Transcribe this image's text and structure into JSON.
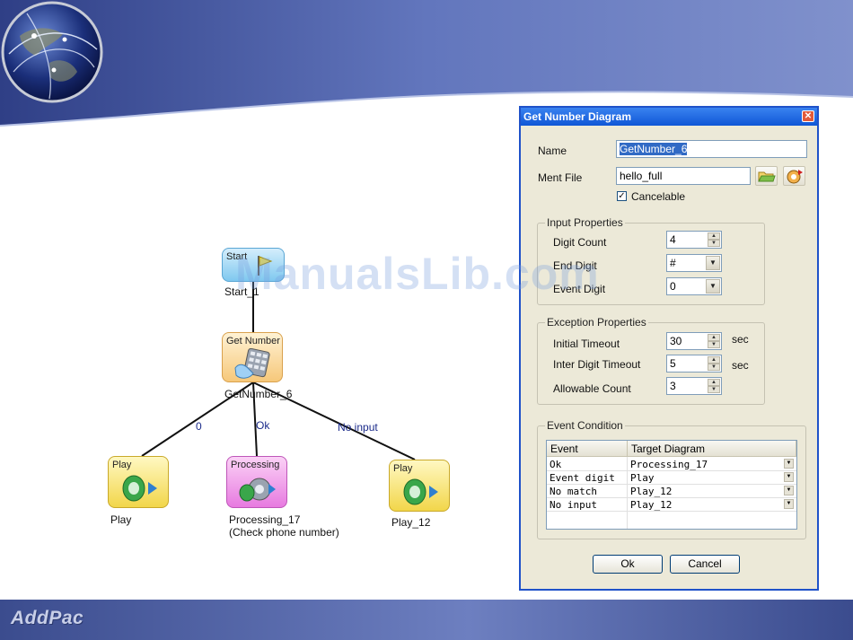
{
  "brand": {
    "logo_text": "AddPac"
  },
  "watermark": "ManualsLib.com",
  "flow": {
    "start": {
      "title": "Start",
      "label": "Start_1"
    },
    "getnumber": {
      "title": "Get Number",
      "label": "GetNumber_6"
    },
    "play1": {
      "title": "Play",
      "label": "Play"
    },
    "processing": {
      "title": "Processing",
      "label_line1": "Processing_17",
      "label_line2": "(Check phone number)"
    },
    "play2": {
      "title": "Play",
      "label": "Play_12"
    },
    "edges": {
      "zero": "0",
      "ok": "Ok",
      "no_input": "No input"
    }
  },
  "dialog": {
    "title": "Get Number Diagram",
    "name_label": "Name",
    "name_value": "GetNumber_6",
    "ment_label": "Ment File",
    "ment_value": "hello_full",
    "cancelable_label": "Cancelable",
    "cancelable_checked": "✓",
    "input_group": {
      "title": "Input Properties",
      "digit_count_label": "Digit Count",
      "digit_count_value": "4",
      "end_digit_label": "End Digit",
      "end_digit_value": "#",
      "event_digit_label": "Event Digit",
      "event_digit_value": "0"
    },
    "exception_group": {
      "title": "Exception Properties",
      "initial_label": "Initial Timeout",
      "initial_value": "30",
      "initial_unit": "sec",
      "inter_label": "Inter Digit Timeout",
      "inter_value": "5",
      "inter_unit": "sec",
      "allowable_label": "Allowable Count",
      "allowable_value": "3"
    },
    "event_group": {
      "title": "Event Condition",
      "col_event": "Event",
      "col_target": "Target Diagram",
      "rows": [
        {
          "event": "Ok",
          "target": "Processing_17"
        },
        {
          "event": "Event digit",
          "target": "Play"
        },
        {
          "event": "No match",
          "target": "Play_12"
        },
        {
          "event": "No input",
          "target": "Play_12"
        }
      ]
    },
    "ok_label": "Ok",
    "cancel_label": "Cancel"
  }
}
